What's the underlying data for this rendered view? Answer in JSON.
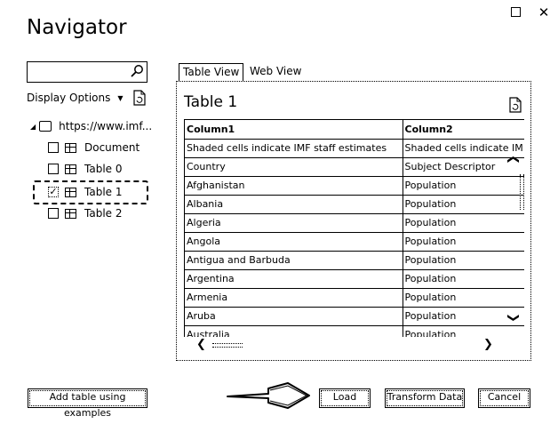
{
  "window": {
    "title": "Navigator",
    "maximize_icon": "maximize-icon",
    "close_icon": "close-icon"
  },
  "left_panel": {
    "search": {
      "value": "",
      "placeholder": ""
    },
    "display_options_label": "Display Options",
    "tree": {
      "root_label": "https://www.imf...",
      "items": [
        {
          "label": "Document",
          "checked": false
        },
        {
          "label": "Table 0",
          "checked": false
        },
        {
          "label": "Table 1",
          "checked": true
        },
        {
          "label": "Table 2",
          "checked": false
        }
      ]
    }
  },
  "right_panel": {
    "tabs": [
      "Table View",
      "Web View"
    ],
    "active_tab": "Table View",
    "preview_title": "Table 1",
    "columns": [
      "Column1",
      "Column2"
    ],
    "rows": [
      [
        "Shaded cells indicate IMF staff estimates",
        "Shaded cells indicate IM"
      ],
      [
        "Country",
        "Subject Descriptor"
      ],
      [
        "Afghanistan",
        "Population"
      ],
      [
        "Albania",
        "Population"
      ],
      [
        "Algeria",
        "Population"
      ],
      [
        "Angola",
        "Population"
      ],
      [
        "Antigua and Barbuda",
        "Population"
      ],
      [
        "Argentina",
        "Population"
      ],
      [
        "Armenia",
        "Population"
      ],
      [
        "Aruba",
        "Population"
      ],
      [
        "Australia",
        "Population"
      ]
    ]
  },
  "footer": {
    "add_table_label": "Add table using examples",
    "load_label": "Load",
    "transform_label": "Transform Data",
    "cancel_label": "Cancel"
  }
}
